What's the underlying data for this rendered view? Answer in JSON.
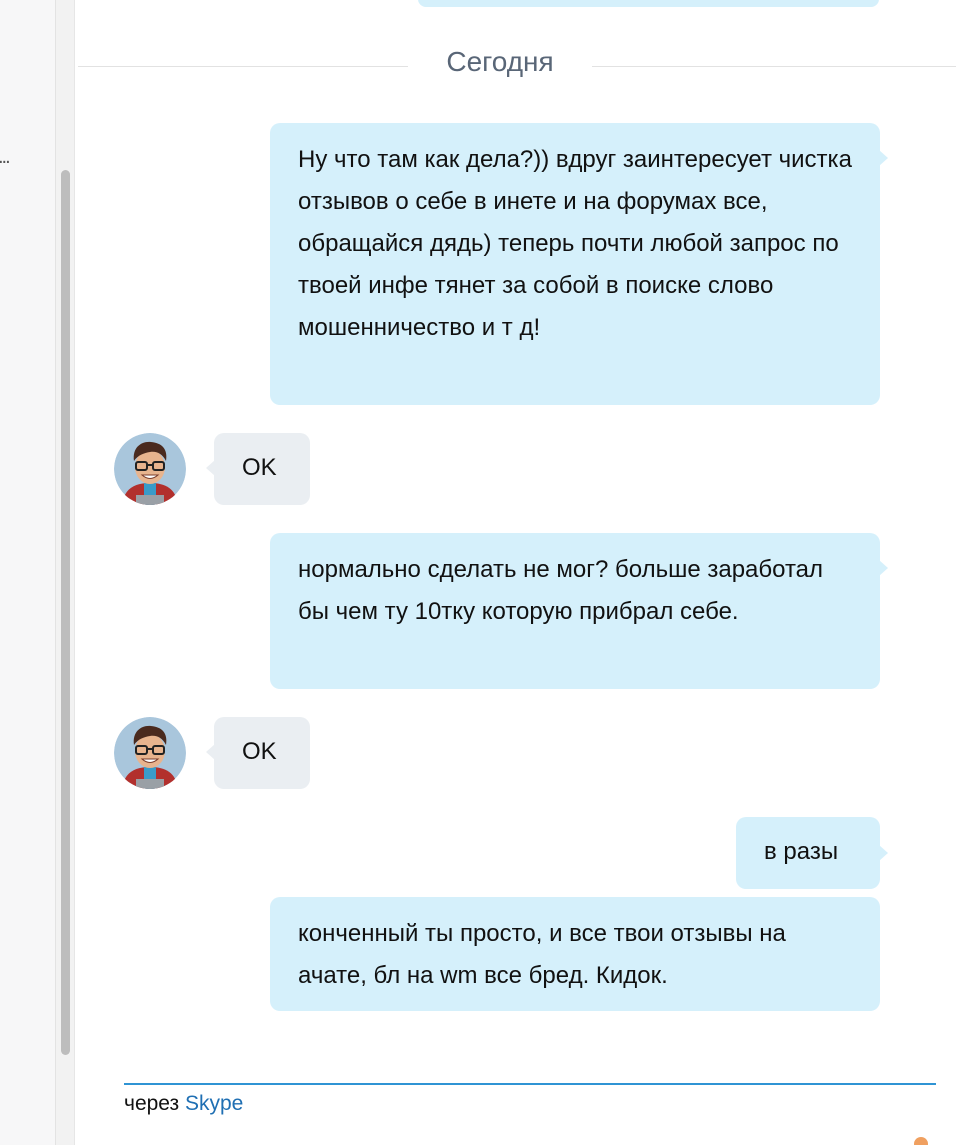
{
  "sidebar": {
    "overflow_text": "..."
  },
  "chat": {
    "date_separator": "Сегодня",
    "messages": [
      {
        "direction": "outgoing",
        "text": "Ну что там как дела?)) вдруг заинтересует чистка отзывов о себе в инете и на форумах все, обращайся дядь) теперь почти любой запрос по твоей инфе тянет за собой в поиске слово мошенничество и т д!"
      },
      {
        "direction": "incoming",
        "text": "OK",
        "avatar": "cartoon-man-with-glasses-avatar"
      },
      {
        "direction": "outgoing",
        "text": "нормально сделать не мог? больше заработал бы чем ту 10тку которую прибрал себе."
      },
      {
        "direction": "incoming",
        "text": "OK",
        "avatar": "cartoon-man-with-glasses-avatar"
      },
      {
        "direction": "outgoing",
        "text": "в разы"
      },
      {
        "direction": "outgoing",
        "text": "конченный ты просто, и все твои отзывы на ачате, бл на wm все бред. Кидок."
      }
    ]
  },
  "footer": {
    "via_label": "через",
    "via_link": "Skype"
  },
  "colors": {
    "outgoing_bubble": "#d5f0fb",
    "incoming_bubble": "#eaeef2",
    "footer_line": "#2f94d4",
    "link": "#1f6fb3",
    "date_label": "#596677"
  }
}
